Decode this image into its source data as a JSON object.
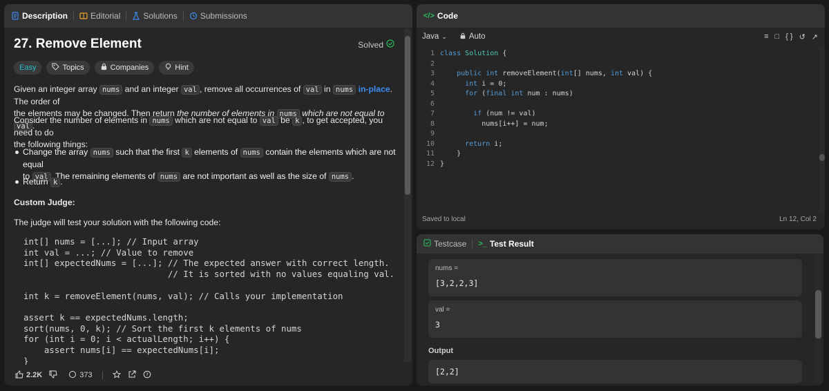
{
  "left_tabs": [
    "Description",
    "Editorial",
    "Solutions",
    "Submissions"
  ],
  "problem": {
    "title": "27. Remove Element",
    "status": "Solved",
    "difficulty": "Easy",
    "chips": [
      "Topics",
      "Companies",
      "Hint"
    ]
  },
  "description": {
    "p1": {
      "a": "Given an integer array ",
      "c1": "nums",
      "b": " and an integer ",
      "c2": "val",
      "c": ", remove all occurrences of ",
      "c3": "val",
      "d": " in ",
      "c4": "nums",
      "link": "in-place",
      "e": ". The order of",
      "f": "the elements may be changed. Then return ",
      "em": "the number of elements in ",
      "c5": "nums",
      "em2": " which are not equal to ",
      "c6": "val",
      "g": "."
    },
    "p2": {
      "a": "Consider the number of elements in ",
      "c1": "nums",
      "b": " which are not equal to ",
      "c2": "val",
      "c": " be ",
      "c3": "k",
      "d": ", to get accepted, you need to do",
      "e": "the following things:"
    },
    "bullet1": {
      "a": "Change the array ",
      "c1": "nums",
      "b": " such that the first ",
      "c2": "k",
      "c": " elements of ",
      "c3": "nums",
      "d": " contain the elements which are not equal",
      "e": "to ",
      "c4": "val",
      "f": ". The remaining elements of ",
      "c5": "nums",
      "g": " are not important as well as the size of ",
      "c6": "nums",
      "h": "."
    },
    "bullet2": {
      "a": "Return ",
      "c1": "k",
      "b": "."
    },
    "custom_judge": "Custom Judge:",
    "judge_intro": "The judge will test your solution with the following code:",
    "judge_code": [
      "int[] nums = [...]; // Input array",
      "int val = ...; // Value to remove",
      "int[] expectedNums = [...]; // The expected answer with correct length.",
      "                            // It is sorted with no values equaling val.",
      "",
      "int k = removeElement(nums, val); // Calls your implementation",
      "",
      "assert k == expectedNums.length;",
      "sort(nums, 0, k); // Sort the first k elements of nums",
      "for (int i = 0; i < actualLength; i++) {",
      "    assert nums[i] == expectedNums[i];",
      "}"
    ]
  },
  "footer": {
    "likes": "2.2K",
    "comments": "373"
  },
  "code_panel": {
    "title": "Code",
    "language": "Java",
    "mode": "Auto",
    "saved": "Saved to local",
    "cursor": "Ln 12, Col 2",
    "lines": [
      {
        "n": "1",
        "t": "class Solution {"
      },
      {
        "n": "2",
        "t": ""
      },
      {
        "n": "3",
        "t": "    public int removeElement(int[] nums, int val) {"
      },
      {
        "n": "4",
        "t": "      int i = 0;"
      },
      {
        "n": "5",
        "t": "      for (final int num : nums)"
      },
      {
        "n": "6",
        "t": ""
      },
      {
        "n": "7",
        "t": "        if (num != val)"
      },
      {
        "n": "8",
        "t": "          nums[i++] = num;"
      },
      {
        "n": "9",
        "t": ""
      },
      {
        "n": "10",
        "t": "      return i;"
      },
      {
        "n": "11",
        "t": "    }"
      },
      {
        "n": "12",
        "t": "}"
      }
    ]
  },
  "test_panel": {
    "tab_testcase": "Testcase",
    "tab_result": "Test Result",
    "nums_label": "nums =",
    "nums_value": "[3,2,2,3]",
    "val_label": "val =",
    "val_value": "3",
    "output_label": "Output",
    "output_value": "[2,2]"
  },
  "colors": {
    "accent": "#3c8cf0",
    "easy": "#27bcc8",
    "solved": "#2cbb5d"
  }
}
